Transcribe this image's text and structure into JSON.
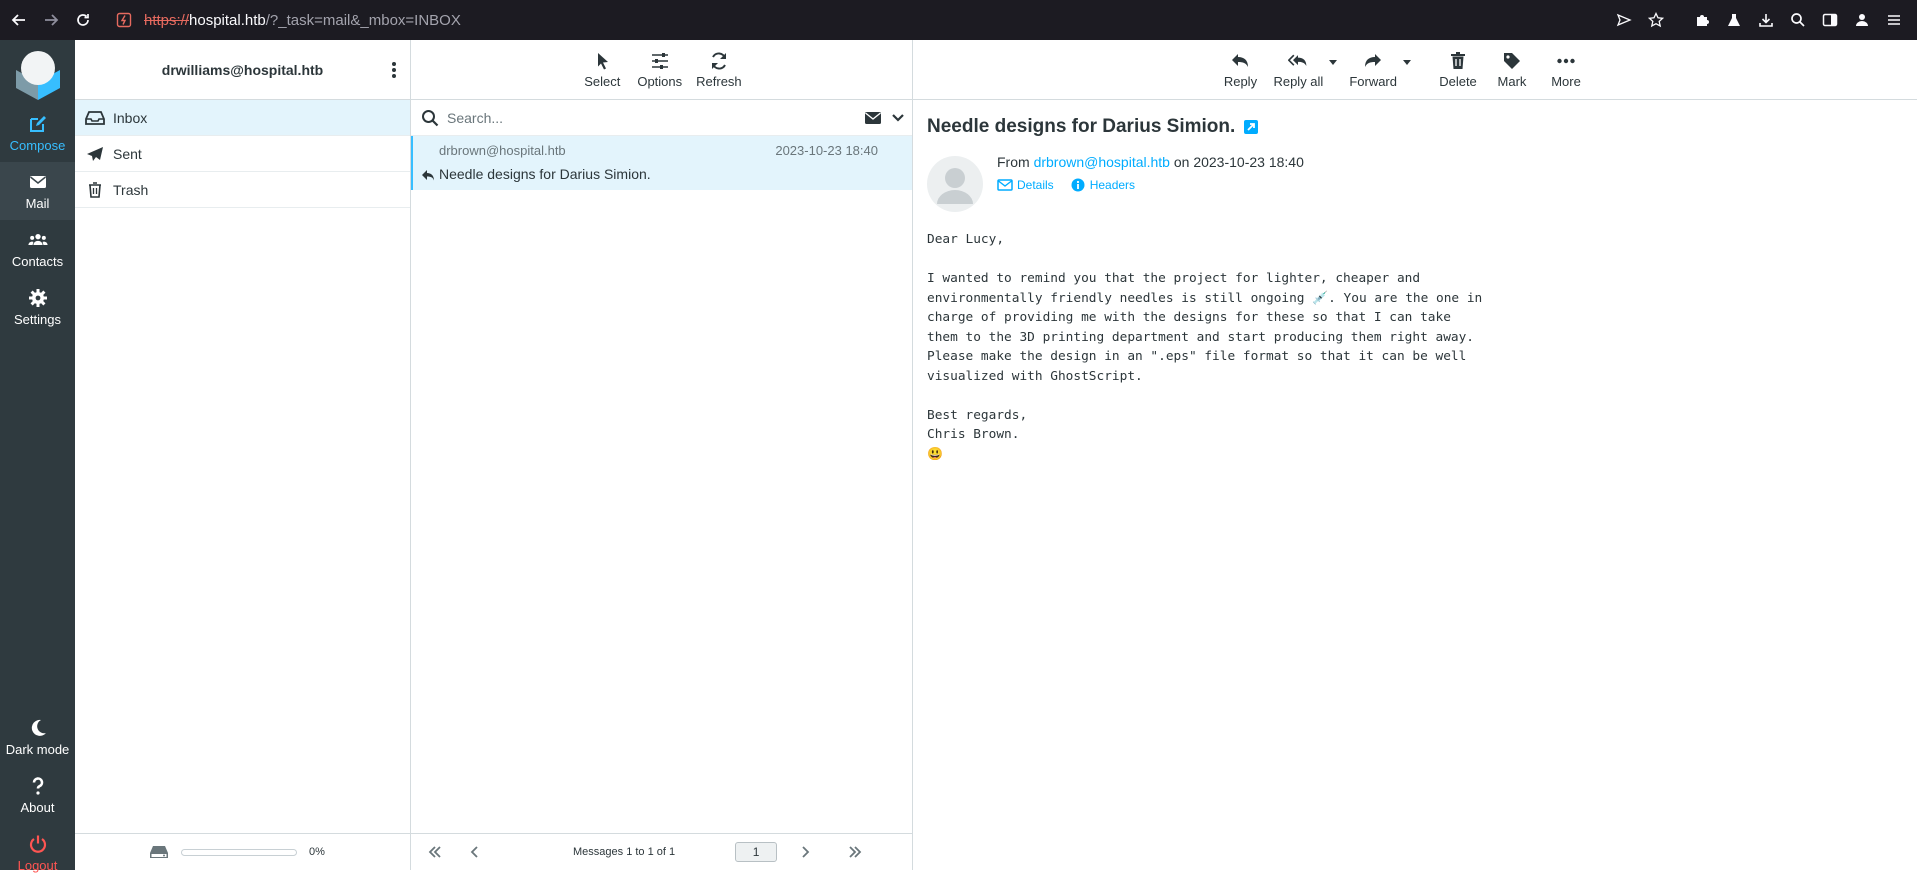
{
  "browser": {
    "url_scheme": "https://",
    "url_host": "hospital.htb",
    "url_path": "/?_task=mail&_mbox=INBOX"
  },
  "nav": {
    "compose": "Compose",
    "mail": "Mail",
    "contacts": "Contacts",
    "settings": "Settings",
    "dark_mode": "Dark mode",
    "about": "About",
    "logout": "Logout"
  },
  "account": "drwilliams@hospital.htb",
  "folders": [
    {
      "label": "Inbox",
      "icon": "inbox-icon"
    },
    {
      "label": "Sent",
      "icon": "paper-plane-icon"
    },
    {
      "label": "Trash",
      "icon": "trash-icon"
    }
  ],
  "quota": {
    "text": "0%",
    "fraction": 0
  },
  "list_toolbar": {
    "select": "Select",
    "options": "Options",
    "refresh": "Refresh"
  },
  "search": {
    "placeholder": "Search..."
  },
  "messages": [
    {
      "from": "drbrown@hospital.htb",
      "date": "2023-10-23 18:40",
      "subject": "Needle designs for Darius Simion.",
      "replied": true
    }
  ],
  "pager": {
    "count": "Messages 1 to 1 of 1",
    "page": "1"
  },
  "preview_toolbar": {
    "reply": "Reply",
    "reply_all": "Reply all",
    "forward": "Forward",
    "delete": "Delete",
    "mark": "Mark",
    "more": "More"
  },
  "message": {
    "subject": "Needle designs for Darius Simion.",
    "from_prefix": "From",
    "from_email": "drbrown@hospital.htb",
    "on_text": "on 2023-10-23 18:40",
    "details": "Details",
    "headers": "Headers",
    "body": "Dear Lucy,\n\nI wanted to remind you that the project for lighter, cheaper and\nenvironmentally friendly needles is still ongoing 💉. You are the one in\ncharge of providing me with the designs for these so that I can take\nthem to the 3D printing department and start producing them right away.\nPlease make the design in an \".eps\" file format so that it can be well\nvisualized with GhostScript.\n\nBest regards,\nChris Brown.\n😃"
  },
  "colors": {
    "accent": "#37beff",
    "link": "#00acff",
    "logout": "#ff5552",
    "nav_bg": "#2f3a3f",
    "selected_bg": "#e3f4fc"
  }
}
